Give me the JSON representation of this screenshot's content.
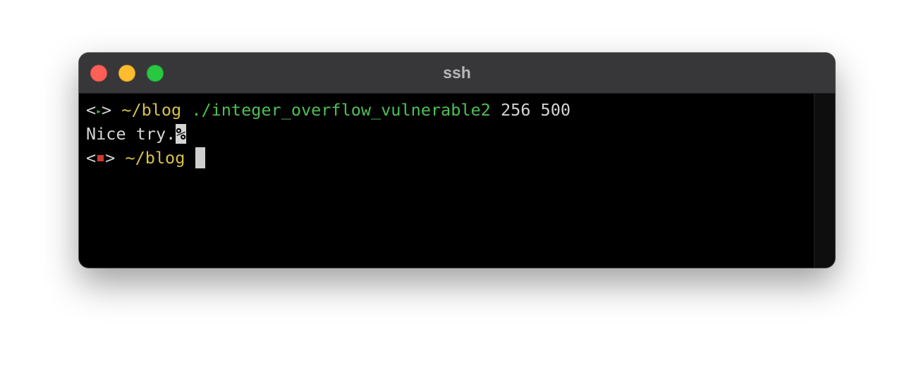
{
  "window": {
    "title": "ssh"
  },
  "terminal": {
    "lines": [
      {
        "prompt_open": "<",
        "status_glyph": "▸",
        "prompt_close": ">",
        "path": "~/blog",
        "command": "./integer_overflow_vulnerable2",
        "args": "256 500"
      },
      {
        "output": "Nice try.",
        "no_newline_marker": "%"
      },
      {
        "prompt_open": "<",
        "status": "error",
        "prompt_close": ">",
        "path": "~/blog"
      }
    ]
  },
  "colors": {
    "path": "#d6c14a",
    "command": "#4fbf55",
    "status_ok": "#3fb54a",
    "status_error": "#cc3b2e",
    "close": "#ff5f57",
    "minimize": "#febc2e",
    "maximize": "#28c840"
  }
}
